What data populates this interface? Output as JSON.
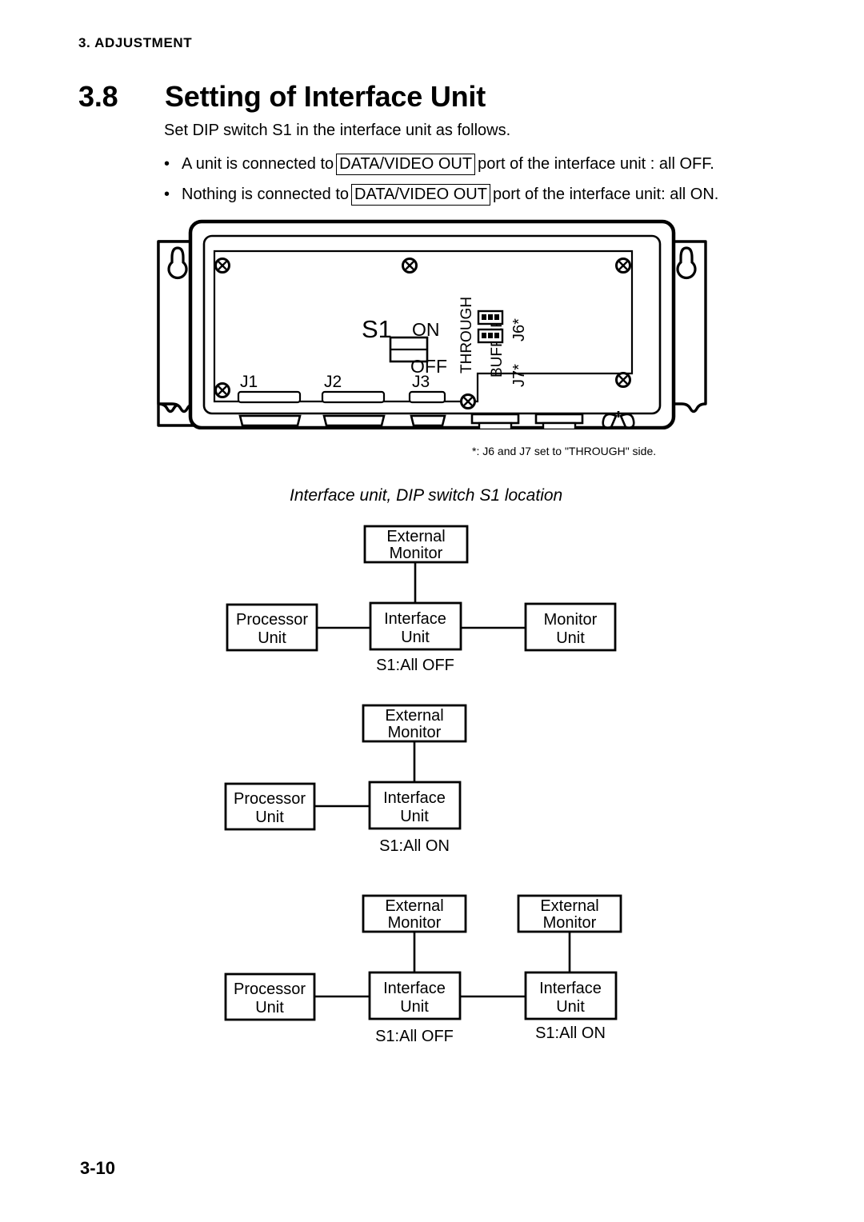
{
  "running_head": "3. ADJUSTMENT",
  "section": {
    "number": "3.8",
    "title": "Setting of Interface Unit"
  },
  "intro_text": "Set DIP switch S1 in the interface unit as follows.",
  "bullets": [
    {
      "marker": "•",
      "before": "A unit is connected to",
      "boxed": "DATA/VIDEO OUT",
      "after": "port of the interface unit : all OFF."
    },
    {
      "marker": "•",
      "before": "Nothing is connected to",
      "boxed": "DATA/VIDEO OUT",
      "after": "port of the interface unit: all ON."
    }
  ],
  "drawing": {
    "switch_label": "S1",
    "switch_on": "ON",
    "switch_off": "OFF",
    "jumper_through": "THROUGH",
    "jumper_buffer": "BUFFER",
    "jumper_j6": "J6*",
    "jumper_j7": "J7*",
    "connectors": [
      "J1",
      "J2",
      "J3"
    ],
    "footnote": "*: J6 and J7 set to \"THROUGH\" side.",
    "caption": "Interface unit, DIP switch S1 location"
  },
  "diagrams": [
    {
      "id": "diagram-all-off",
      "external_monitor": "External\nMonitor",
      "external_monitor_l1": "External",
      "external_monitor_l2": "Monitor",
      "processor_l1": "Processor",
      "processor_l2": "Unit",
      "interface_l1": "Interface",
      "interface_l2": "Unit",
      "monitor_l1": "Monitor",
      "monitor_l2": "Unit",
      "caption": "S1:All OFF"
    },
    {
      "id": "diagram-all-on",
      "external_monitor_l1": "External",
      "external_monitor_l2": "Monitor",
      "processor_l1": "Processor",
      "processor_l2": "Unit",
      "interface_l1": "Interface",
      "interface_l2": "Unit",
      "caption": "S1:All ON"
    },
    {
      "id": "diagram-dual-interface",
      "external_monitor_a_l1": "External",
      "external_monitor_a_l2": "Monitor",
      "external_monitor_b_l1": "External",
      "external_monitor_b_l2": "Monitor",
      "processor_l1": "Processor",
      "processor_l2": "Unit",
      "interface_a_l1": "Interface",
      "interface_a_l2": "Unit",
      "interface_b_l1": "Interface",
      "interface_b_l2": "Unit",
      "caption_a": "S1:All OFF",
      "caption_b": "S1:All ON"
    }
  ],
  "page_number": "3-10",
  "colors": {
    "ink": "#000000",
    "paper": "#ffffff"
  }
}
